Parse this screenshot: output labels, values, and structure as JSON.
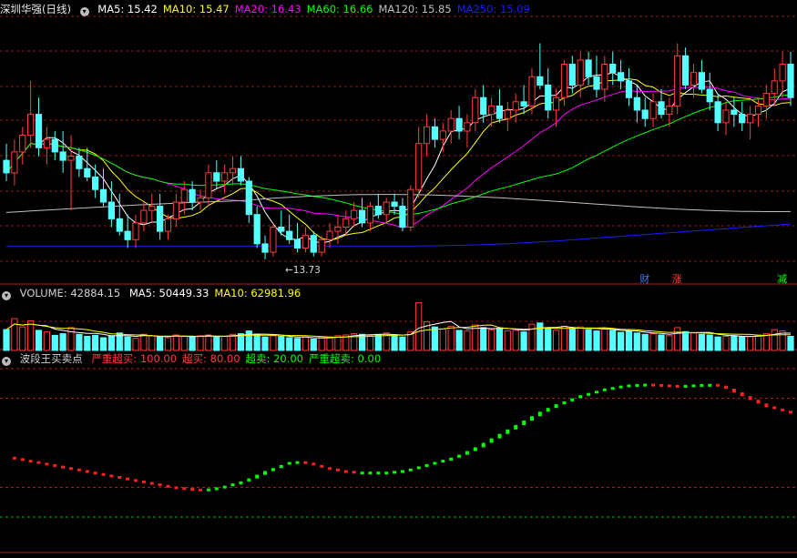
{
  "price_panel": {
    "title": "深圳华强(日线)",
    "ma": [
      {
        "label": "MA5: 15.42",
        "color": "#ffffff"
      },
      {
        "label": "MA10: 15.47",
        "color": "#ffff00"
      },
      {
        "label": "MA20: 16.43",
        "color": "#ff00ff"
      },
      {
        "label": "MA60: 16.66",
        "color": "#00ff00"
      },
      {
        "label": "MA120: 15.85",
        "color": "#c0c0c0"
      },
      {
        "label": "MA250: 15.09",
        "color": "#1c1cff"
      }
    ],
    "low_marker": "←13.73",
    "events": [
      {
        "label": "财",
        "color": "#3a7bff",
        "at": 79
      },
      {
        "label": "涨",
        "color": "#ff3b3b",
        "at": 83
      },
      {
        "label": "减",
        "color": "#00ff00",
        "at": 96
      }
    ]
  },
  "volume_panel": {
    "title": "VOLUME: 42884.15",
    "ma": [
      {
        "label": "MA5: 50449.33",
        "color": "#ffffff"
      },
      {
        "label": "MA10: 62981.96",
        "color": "#ffff00"
      }
    ]
  },
  "indicator_panel": {
    "title": "波段王买卖点",
    "levels": [
      {
        "label": "严重超买: 100.00",
        "color": "#ff3b3b"
      },
      {
        "label": "超买: 80.00",
        "color": "#ff3b3b"
      },
      {
        "label": "超卖: 20.00",
        "color": "#00ff00"
      },
      {
        "label": "严重超卖: 0.00",
        "color": "#00ff00"
      }
    ]
  },
  "colors": {
    "up": "#ff3b3b",
    "down": "#54ffff",
    "bg": "#000000",
    "grid": "#8b1a1a",
    "ma5": "#ffffff",
    "ma10": "#ffff00",
    "ma20": "#ff00ff",
    "ma60": "#00ff00",
    "ma120": "#c0c0c0",
    "ma250": "#1c1cff",
    "ind_up": "#00ff00",
    "ind_down": "#ff2020"
  },
  "chart_data": {
    "type": "candlestick",
    "title": "深圳华强(日线)",
    "ylim": [
      13.4,
      19.5
    ],
    "candles": [
      [
        16.1,
        16.5,
        15.6,
        15.8
      ],
      [
        15.8,
        16.6,
        15.5,
        16.3
      ],
      [
        16.3,
        16.9,
        16.0,
        16.7
      ],
      [
        16.7,
        18.0,
        16.4,
        17.2
      ],
      [
        17.2,
        17.6,
        16.2,
        16.4
      ],
      [
        16.4,
        16.9,
        16.0,
        16.6
      ],
      [
        16.6,
        16.8,
        16.1,
        16.3
      ],
      [
        16.3,
        16.8,
        15.8,
        16.1
      ],
      [
        16.1,
        16.7,
        14.9,
        16.2
      ],
      [
        16.2,
        16.4,
        15.7,
        15.9
      ],
      [
        15.9,
        16.4,
        15.6,
        15.7
      ],
      [
        15.7,
        16.0,
        15.2,
        15.4
      ],
      [
        15.4,
        15.9,
        15.0,
        15.1
      ],
      [
        15.1,
        15.6,
        14.5,
        14.7
      ],
      [
        14.7,
        15.3,
        14.3,
        14.4
      ],
      [
        14.4,
        14.8,
        14.0,
        14.2
      ],
      [
        14.2,
        14.8,
        14.0,
        14.6
      ],
      [
        14.6,
        15.1,
        14.4,
        14.9
      ],
      [
        14.9,
        15.3,
        14.6,
        15.0
      ],
      [
        15.0,
        15.3,
        14.2,
        14.4
      ],
      [
        14.4,
        14.8,
        14.2,
        14.7
      ],
      [
        14.7,
        15.3,
        14.5,
        15.1
      ],
      [
        15.1,
        15.6,
        14.8,
        15.4
      ],
      [
        15.4,
        15.6,
        14.9,
        15.1
      ],
      [
        15.1,
        15.4,
        14.9,
        15.2
      ],
      [
        15.2,
        16.0,
        15.0,
        15.8
      ],
      [
        15.8,
        16.1,
        15.4,
        15.6
      ],
      [
        15.6,
        16.0,
        15.3,
        15.8
      ],
      [
        15.8,
        16.2,
        15.5,
        15.9
      ],
      [
        15.9,
        16.2,
        15.5,
        15.6
      ],
      [
        15.6,
        15.7,
        14.6,
        14.8
      ],
      [
        14.8,
        15.0,
        14.0,
        14.1
      ],
      [
        14.1,
        14.3,
        13.73,
        13.9
      ],
      [
        13.9,
        14.6,
        13.8,
        14.5
      ],
      [
        14.5,
        14.9,
        14.3,
        14.4
      ],
      [
        14.4,
        14.8,
        14.1,
        14.2
      ],
      [
        14.2,
        14.6,
        13.9,
        14.0
      ],
      [
        14.0,
        14.5,
        13.9,
        14.3
      ],
      [
        14.3,
        14.4,
        13.8,
        13.9
      ],
      [
        13.9,
        14.3,
        13.8,
        14.2
      ],
      [
        14.2,
        14.6,
        14.0,
        14.4
      ],
      [
        14.4,
        14.8,
        14.1,
        14.5
      ],
      [
        14.5,
        14.9,
        14.3,
        14.7
      ],
      [
        14.7,
        15.1,
        14.5,
        14.9
      ],
      [
        14.9,
        15.2,
        14.5,
        14.6
      ],
      [
        14.6,
        15.1,
        14.4,
        15.0
      ],
      [
        15.0,
        15.3,
        14.7,
        14.8
      ],
      [
        14.8,
        15.2,
        14.6,
        15.1
      ],
      [
        15.1,
        15.3,
        14.8,
        15.0
      ],
      [
        15.0,
        15.2,
        14.4,
        14.5
      ],
      [
        14.5,
        15.5,
        14.4,
        15.4
      ],
      [
        15.4,
        16.9,
        15.2,
        16.5
      ],
      [
        16.5,
        17.2,
        16.2,
        16.9
      ],
      [
        16.9,
        17.1,
        16.4,
        16.6
      ],
      [
        16.6,
        17.0,
        16.3,
        16.8
      ],
      [
        16.8,
        17.3,
        16.5,
        17.1
      ],
      [
        17.1,
        17.4,
        16.6,
        16.8
      ],
      [
        16.8,
        17.2,
        16.4,
        17.0
      ],
      [
        17.0,
        17.8,
        16.8,
        17.6
      ],
      [
        17.6,
        17.9,
        17.0,
        17.2
      ],
      [
        17.2,
        17.6,
        16.9,
        17.4
      ],
      [
        17.4,
        17.8,
        17.0,
        17.1
      ],
      [
        17.1,
        17.5,
        16.8,
        17.3
      ],
      [
        17.3,
        17.7,
        17.0,
        17.5
      ],
      [
        17.5,
        17.9,
        17.2,
        17.4
      ],
      [
        17.4,
        18.3,
        17.2,
        18.1
      ],
      [
        18.1,
        18.9,
        17.8,
        17.9
      ],
      [
        17.9,
        18.3,
        17.1,
        17.3
      ],
      [
        17.3,
        17.8,
        16.9,
        17.6
      ],
      [
        17.6,
        18.5,
        17.4,
        18.4
      ],
      [
        18.4,
        18.6,
        17.7,
        17.9
      ],
      [
        17.9,
        18.7,
        17.6,
        18.5
      ],
      [
        18.5,
        18.7,
        17.9,
        18.1
      ],
      [
        18.1,
        18.6,
        17.6,
        17.8
      ],
      [
        17.8,
        18.6,
        17.5,
        18.4
      ],
      [
        18.4,
        18.7,
        17.9,
        18.2
      ],
      [
        18.2,
        18.5,
        17.8,
        18.0
      ],
      [
        18.0,
        18.3,
        17.4,
        17.6
      ],
      [
        17.6,
        17.9,
        17.0,
        17.3
      ],
      [
        17.3,
        17.6,
        16.9,
        17.1
      ],
      [
        17.1,
        17.7,
        16.9,
        17.5
      ],
      [
        17.5,
        17.8,
        17.1,
        17.2
      ],
      [
        17.2,
        17.6,
        16.9,
        17.4
      ],
      [
        17.4,
        18.9,
        17.2,
        18.6
      ],
      [
        18.6,
        18.8,
        17.8,
        17.9
      ],
      [
        17.9,
        18.4,
        17.6,
        18.2
      ],
      [
        18.2,
        18.5,
        17.7,
        17.8
      ],
      [
        17.8,
        18.2,
        17.3,
        17.5
      ],
      [
        17.5,
        17.7,
        16.8,
        17.0
      ],
      [
        17.0,
        17.5,
        16.7,
        17.3
      ],
      [
        17.3,
        17.6,
        16.9,
        17.2
      ],
      [
        17.2,
        17.5,
        16.8,
        17.0
      ],
      [
        17.0,
        17.4,
        16.6,
        17.2
      ],
      [
        17.2,
        17.6,
        16.9,
        17.4
      ],
      [
        17.4,
        17.9,
        17.1,
        17.7
      ],
      [
        17.7,
        18.3,
        17.4,
        18.0
      ],
      [
        18.0,
        18.7,
        17.6,
        18.4
      ],
      [
        18.4,
        18.7,
        17.4,
        17.6
      ]
    ],
    "volume": [
      62,
      95,
      70,
      88,
      60,
      55,
      45,
      50,
      68,
      48,
      42,
      45,
      38,
      44,
      52,
      40,
      36,
      48,
      44,
      40,
      38,
      46,
      42,
      40,
      44,
      46,
      40,
      42,
      48,
      50,
      58,
      46,
      40,
      44,
      42,
      38,
      36,
      40,
      34,
      38,
      40,
      44,
      46,
      50,
      48,
      45,
      48,
      52,
      44,
      40,
      55,
      142,
      85,
      70,
      64,
      72,
      60,
      58,
      76,
      68,
      62,
      66,
      58,
      60,
      55,
      78,
      82,
      66,
      60,
      72,
      64,
      70,
      62,
      58,
      66,
      60,
      54,
      58,
      52,
      48,
      50,
      46,
      44,
      68,
      56,
      52,
      48,
      46,
      40,
      42,
      44,
      40,
      42,
      46,
      50,
      62,
      58,
      42
    ],
    "indicator": [
      40,
      39,
      38,
      37,
      36,
      35,
      34,
      33,
      32,
      31,
      30,
      29,
      28,
      27,
      26,
      25,
      24,
      23,
      22,
      21,
      20,
      19.5,
      19,
      18.5,
      18.3,
      18.6,
      19.4,
      20.5,
      22,
      24,
      26,
      28.5,
      31,
      33,
      35,
      36.5,
      37,
      36,
      34.5,
      33,
      32,
      31,
      30.5,
      30,
      30,
      30,
      30,
      30,
      30.5,
      31,
      32,
      33.5,
      35,
      36.5,
      38,
      40,
      42,
      44.5,
      47,
      50,
      53,
      56,
      59,
      62,
      65,
      68,
      71,
      73.5,
      76,
      78,
      80,
      81.5,
      83,
      84.5,
      86,
      87,
      88,
      88.7,
      89,
      89.2,
      89,
      88.7,
      88.4,
      88.2,
      88.4,
      88.8,
      89,
      89.1,
      88.5,
      86.5,
      84,
      81.5,
      79,
      76.5,
      74,
      72.5,
      71,
      70.5
    ]
  }
}
